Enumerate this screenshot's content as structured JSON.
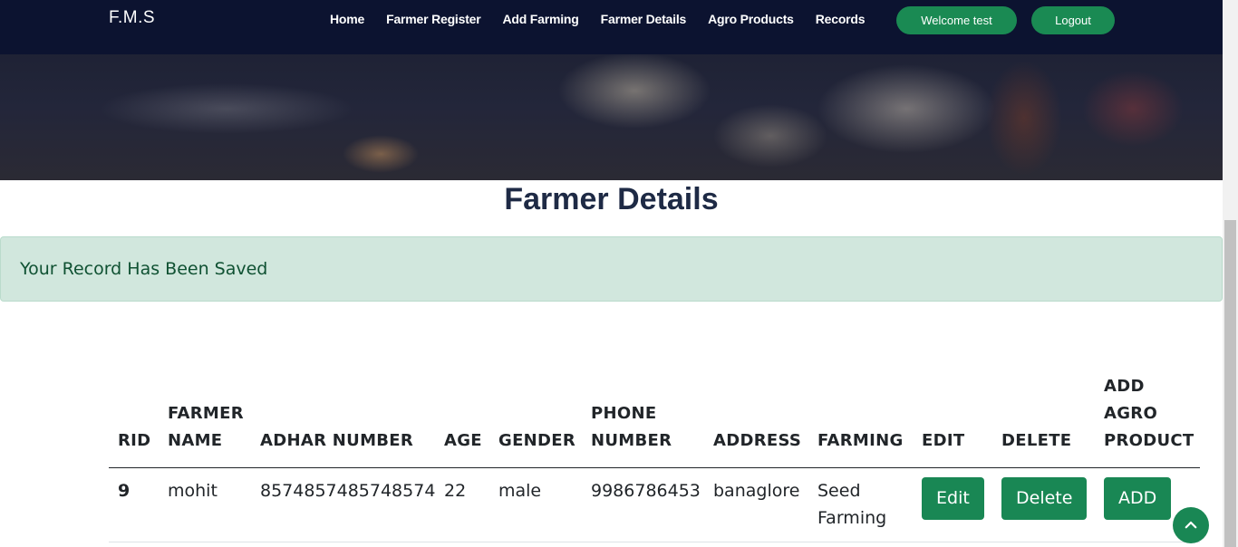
{
  "brand": "F.M.S",
  "nav": {
    "links": [
      "Home",
      "Farmer Register",
      "Add Farming",
      "Farmer Details",
      "Agro Products",
      "Records"
    ],
    "welcome": "Welcome test",
    "logout": "Logout"
  },
  "page_title": "Farmer Details",
  "alert": "Your Record Has Been Saved",
  "table": {
    "headers": [
      "RID",
      "FARMER NAME",
      "ADHAR NUMBER",
      "AGE",
      "GENDER",
      "PHONE NUMBER",
      "ADDRESS",
      "FARMING",
      "EDIT",
      "DELETE",
      "ADD AGRO PRODUCT"
    ],
    "rows": [
      {
        "rid": "9",
        "farmer_name": "mohit",
        "adhar": "8574857485748574",
        "age": "22",
        "gender": "male",
        "phone": "9986786453",
        "address": "banaglore",
        "farming": "Seed Farming",
        "edit_label": "Edit",
        "delete_label": "Delete",
        "add_label": "ADD"
      }
    ]
  },
  "icons": {
    "back_to_top": "chevron-up-icon"
  },
  "colors": {
    "navbar": "#0c1330",
    "accent": "#198754",
    "alert_bg": "#d1e7dd",
    "alert_text": "#0f5132"
  }
}
